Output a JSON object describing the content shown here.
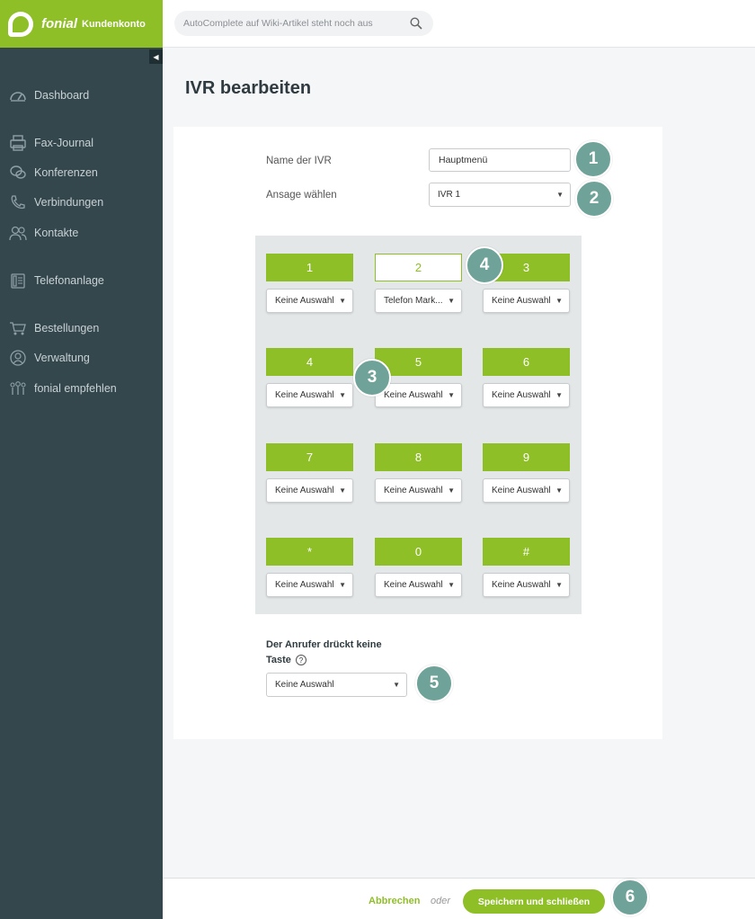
{
  "brand": {
    "name": "fonial",
    "subtitle": "Kundenkonto",
    "color": "#8fbf26"
  },
  "search": {
    "placeholder": "AutoComplete auf Wiki-Artikel steht noch aus",
    "icon": "search-icon"
  },
  "sidebar": {
    "collapse_glyph": "◀",
    "items": [
      {
        "label": "Dashboard",
        "icon": "dashboard-icon"
      },
      {
        "label": "Fax-Journal",
        "icon": "fax-icon"
      },
      {
        "label": "Konferenzen",
        "icon": "conference-icon"
      },
      {
        "label": "Verbindungen",
        "icon": "phone-icon"
      },
      {
        "label": "Kontakte",
        "icon": "contacts-icon"
      },
      {
        "label": "Telefonanlage",
        "icon": "phone-system-icon"
      },
      {
        "label": "Bestellungen",
        "icon": "cart-icon"
      },
      {
        "label": "Verwaltung",
        "icon": "user-icon"
      },
      {
        "label": "fonial empfehlen",
        "icon": "recommend-icon"
      }
    ]
  },
  "page": {
    "title": "IVR bearbeiten"
  },
  "form": {
    "name_label": "Name der IVR",
    "name_value": "Hauptmenü",
    "announcement_label": "Ansage wählen",
    "announcement_value": "IVR 1",
    "caret": "▼"
  },
  "keypad": {
    "keys": [
      {
        "key": "1",
        "selection": "Keine Auswahl",
        "active": false
      },
      {
        "key": "2",
        "selection": "Telefon Mark...",
        "active": true
      },
      {
        "key": "3",
        "selection": "Keine Auswahl",
        "active": false
      },
      {
        "key": "4",
        "selection": "Keine Auswahl",
        "active": false
      },
      {
        "key": "5",
        "selection": "Keine Auswahl",
        "active": false
      },
      {
        "key": "6",
        "selection": "Keine Auswahl",
        "active": false
      },
      {
        "key": "7",
        "selection": "Keine Auswahl",
        "active": false
      },
      {
        "key": "8",
        "selection": "Keine Auswahl",
        "active": false
      },
      {
        "key": "9",
        "selection": "Keine Auswahl",
        "active": false
      },
      {
        "key": "*",
        "selection": "Keine Auswahl",
        "active": false
      },
      {
        "key": "0",
        "selection": "Keine Auswahl",
        "active": false
      },
      {
        "key": "#",
        "selection": "Keine Auswahl",
        "active": false
      }
    ]
  },
  "no_key": {
    "label": "Der Anrufer drückt keine Taste",
    "help": "?",
    "selection": "Keine Auswahl"
  },
  "badges": [
    "1",
    "2",
    "3",
    "4",
    "5",
    "6"
  ],
  "footer": {
    "cancel_label": "Abbrechen",
    "or_label": "oder",
    "save_label": "Speichern und schließen"
  }
}
